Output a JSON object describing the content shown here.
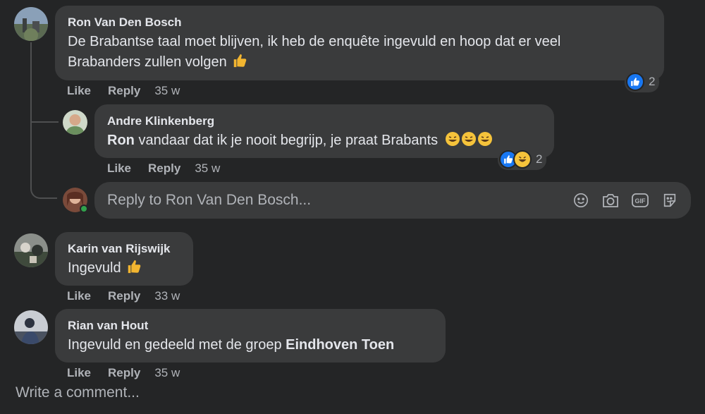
{
  "comments": [
    {
      "author": "Ron Van Den Bosch",
      "text_line1": "De Brabantse taal moet blijven, ik heb de enquête ingevuld en hoop dat er veel",
      "text_line2": "Brabanders zullen volgen",
      "reaction_count": "2",
      "like_label": "Like",
      "reply_label": "Reply",
      "time": "35 w"
    },
    {
      "author": "Andre Klinkenberg",
      "mention": "Ron",
      "text": " vandaar dat ik je nooit begrijp, je praat Brabants",
      "reaction_count": "2",
      "like_label": "Like",
      "reply_label": "Reply",
      "time": "35 w"
    },
    {
      "author": "Karin van Rijswijk",
      "text": "Ingevuld",
      "like_label": "Like",
      "reply_label": "Reply",
      "time": "33 w"
    },
    {
      "author": "Rian van Hout",
      "text": "Ingevuld en gedeeld met de groep ",
      "mention": "Eindhoven Toen",
      "like_label": "Like",
      "reply_label": "Reply",
      "time": "35 w"
    }
  ],
  "reply_box": {
    "placeholder": "Reply to Ron Van Den Bosch...",
    "gif_label": "GIF"
  },
  "write_comment": "Write a comment...",
  "colors": {
    "background": "#242526",
    "bubble": "#3a3b3c",
    "like_blue": "#1877f2",
    "online_green": "#31a24c"
  }
}
